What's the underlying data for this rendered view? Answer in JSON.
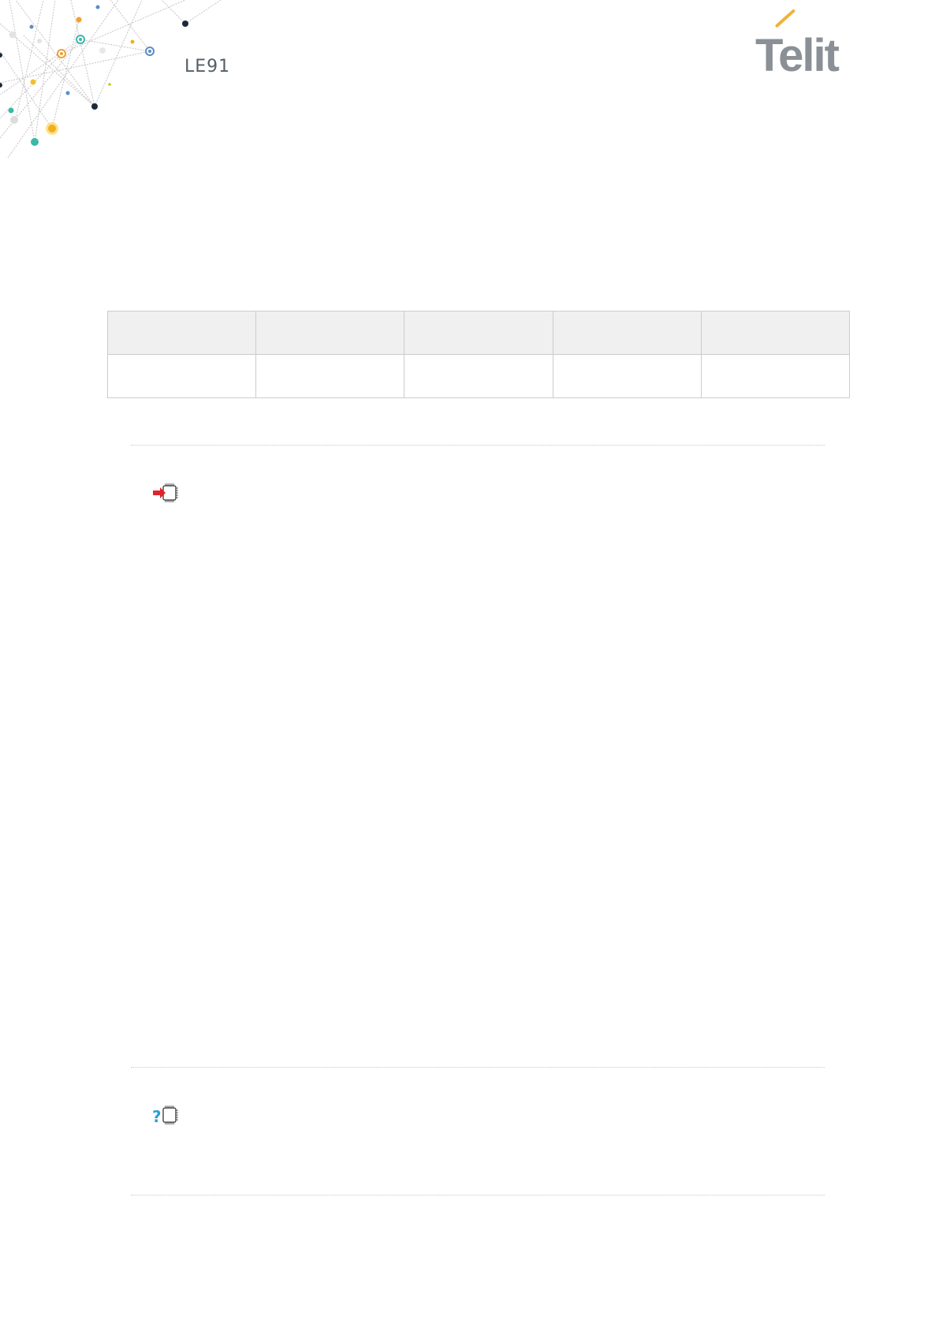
{
  "header": {
    "product": "LE91",
    "logo_text": "Telit"
  },
  "icons": {
    "set_command": "set-command-icon",
    "read_command": "read-command-icon"
  },
  "table": {
    "header_cells": [
      "",
      "",
      "",
      "",
      ""
    ],
    "row_cells": [
      "",
      "",
      "",
      "",
      ""
    ]
  },
  "colors": {
    "accent_red": "#e0242b",
    "accent_blue": "#2aa0d8",
    "logo_gray": "#8a9096",
    "logo_orange": "#f0b23a"
  }
}
